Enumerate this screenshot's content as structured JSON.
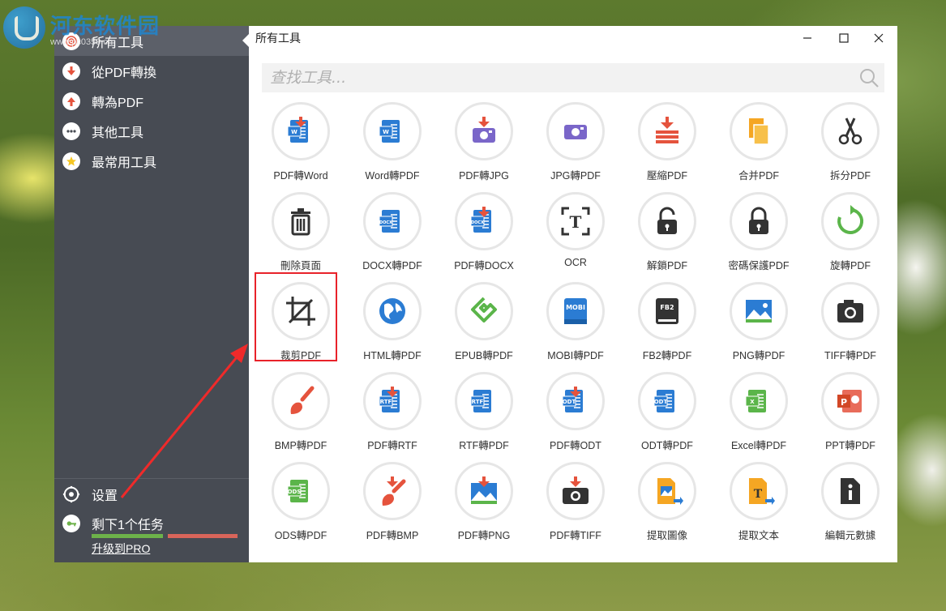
{
  "watermark": {
    "text": "河东软件园",
    "url": "www.pc0359.cn"
  },
  "sidebar": {
    "items": [
      {
        "label": "所有工具",
        "icon": "target-icon",
        "active": true
      },
      {
        "label": "從PDF轉換",
        "icon": "arrow-down-icon",
        "active": false
      },
      {
        "label": "轉為PDF",
        "icon": "arrow-up-icon",
        "active": false
      },
      {
        "label": "其他工具",
        "icon": "more-dots-icon",
        "active": false
      },
      {
        "label": "最常用工具",
        "icon": "star-icon",
        "active": false
      }
    ],
    "settings_label": "设置",
    "tasks_label": "剩下1个任务",
    "upgrade_label": "升级到PRO",
    "task_progress": 0.5
  },
  "window": {
    "title": "所有工具",
    "search_placeholder": "查找工具..."
  },
  "tools": [
    {
      "label": "PDF轉Word",
      "icon": "pdf-to-word-icon"
    },
    {
      "label": "Word轉PDF",
      "icon": "word-icon"
    },
    {
      "label": "PDF轉JPG",
      "icon": "pdf-to-jpg-icon"
    },
    {
      "label": "JPG轉PDF",
      "icon": "jpg-icon"
    },
    {
      "label": "壓縮PDF",
      "icon": "compress-icon"
    },
    {
      "label": "合并PDF",
      "icon": "merge-icon"
    },
    {
      "label": "拆分PDF",
      "icon": "scissors-icon"
    },
    {
      "label": "刪除頁面",
      "icon": "trash-icon"
    },
    {
      "label": "DOCX轉PDF",
      "icon": "docx-icon"
    },
    {
      "label": "PDF轉DOCX",
      "icon": "pdf-to-docx-icon"
    },
    {
      "label": "OCR",
      "icon": "ocr-icon"
    },
    {
      "label": "解鎖PDF",
      "icon": "unlock-icon"
    },
    {
      "label": "密碼保護PDF",
      "icon": "lock-icon"
    },
    {
      "label": "旋轉PDF",
      "icon": "rotate-icon"
    },
    {
      "label": "裁剪PDF",
      "icon": "crop-icon"
    },
    {
      "label": "HTML轉PDF",
      "icon": "globe-icon"
    },
    {
      "label": "EPUB轉PDF",
      "icon": "epub-icon"
    },
    {
      "label": "MOBI轉PDF",
      "icon": "mobi-icon"
    },
    {
      "label": "FB2轉PDF",
      "icon": "fb2-icon"
    },
    {
      "label": "PNG轉PDF",
      "icon": "image-icon"
    },
    {
      "label": "TIFF轉PDF",
      "icon": "camera-icon"
    },
    {
      "label": "BMP轉PDF",
      "icon": "brush-icon"
    },
    {
      "label": "PDF轉RTF",
      "icon": "pdf-to-rtf-icon"
    },
    {
      "label": "RTF轉PDF",
      "icon": "rtf-icon"
    },
    {
      "label": "PDF轉ODT",
      "icon": "pdf-to-odt-icon"
    },
    {
      "label": "ODT轉PDF",
      "icon": "odt-icon"
    },
    {
      "label": "Excel轉PDF",
      "icon": "excel-icon"
    },
    {
      "label": "PPT轉PDF",
      "icon": "powerpoint-icon"
    },
    {
      "label": "ODS轉PDF",
      "icon": "ods-icon"
    },
    {
      "label": "PDF轉BMP",
      "icon": "pdf-to-bmp-icon"
    },
    {
      "label": "PDF轉PNG",
      "icon": "pdf-to-png-icon"
    },
    {
      "label": "PDF轉TIFF",
      "icon": "pdf-to-tiff-icon"
    },
    {
      "label": "提取圖像",
      "icon": "extract-image-icon"
    },
    {
      "label": "提取文本",
      "icon": "extract-text-icon"
    },
    {
      "label": "編輯元數據",
      "icon": "info-file-icon"
    }
  ],
  "highlighted_tool": "裁剪PDF",
  "colors": {
    "sidebar_bg": "#474b53",
    "accent_red": "#e8222a",
    "word_blue": "#2b7cd3",
    "download_red": "#e5533d"
  }
}
